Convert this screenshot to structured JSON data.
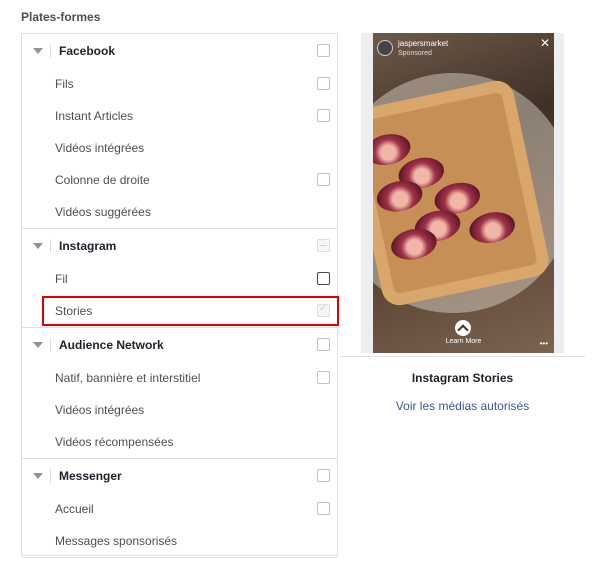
{
  "section_title": "Plates-formes",
  "groups": [
    {
      "label": "Facebook",
      "checkbox": "unchecked",
      "items": [
        {
          "label": "Fils",
          "checkbox": "unchecked"
        },
        {
          "label": "Instant Articles",
          "checkbox": "unchecked"
        },
        {
          "label": "Vidéos intégrées",
          "checkbox": "none"
        },
        {
          "label": "Colonne de droite",
          "checkbox": "unchecked"
        },
        {
          "label": "Vidéos suggérées",
          "checkbox": "none"
        }
      ]
    },
    {
      "label": "Instagram",
      "checkbox": "partial-disabled",
      "items": [
        {
          "label": "Fil",
          "checkbox": "unchecked-dark"
        },
        {
          "label": "Stories",
          "checkbox": "checked-disabled",
          "highlighted": true
        }
      ]
    },
    {
      "label": "Audience Network",
      "checkbox": "unchecked",
      "items": [
        {
          "label": "Natif, bannière et interstitiel",
          "checkbox": "unchecked"
        },
        {
          "label": "Vidéos intégrées",
          "checkbox": "none"
        },
        {
          "label": "Vidéos récompensées",
          "checkbox": "none"
        }
      ]
    },
    {
      "label": "Messenger",
      "checkbox": "unchecked",
      "items": [
        {
          "label": "Accueil",
          "checkbox": "unchecked"
        },
        {
          "label": "Messages sponsorisés",
          "checkbox": "none"
        }
      ]
    }
  ],
  "preview": {
    "account_name": "jaspersmarket",
    "account_sub": "Sponsored",
    "close_icon": "close-icon",
    "cta_label": "Learn More",
    "more_icon": "ellipsis-icon",
    "caption": "Instagram Stories",
    "link": "Voir les médias autorisés"
  },
  "colors": {
    "highlight": "#e00000",
    "link": "#365899",
    "border": "#dddfe2"
  }
}
